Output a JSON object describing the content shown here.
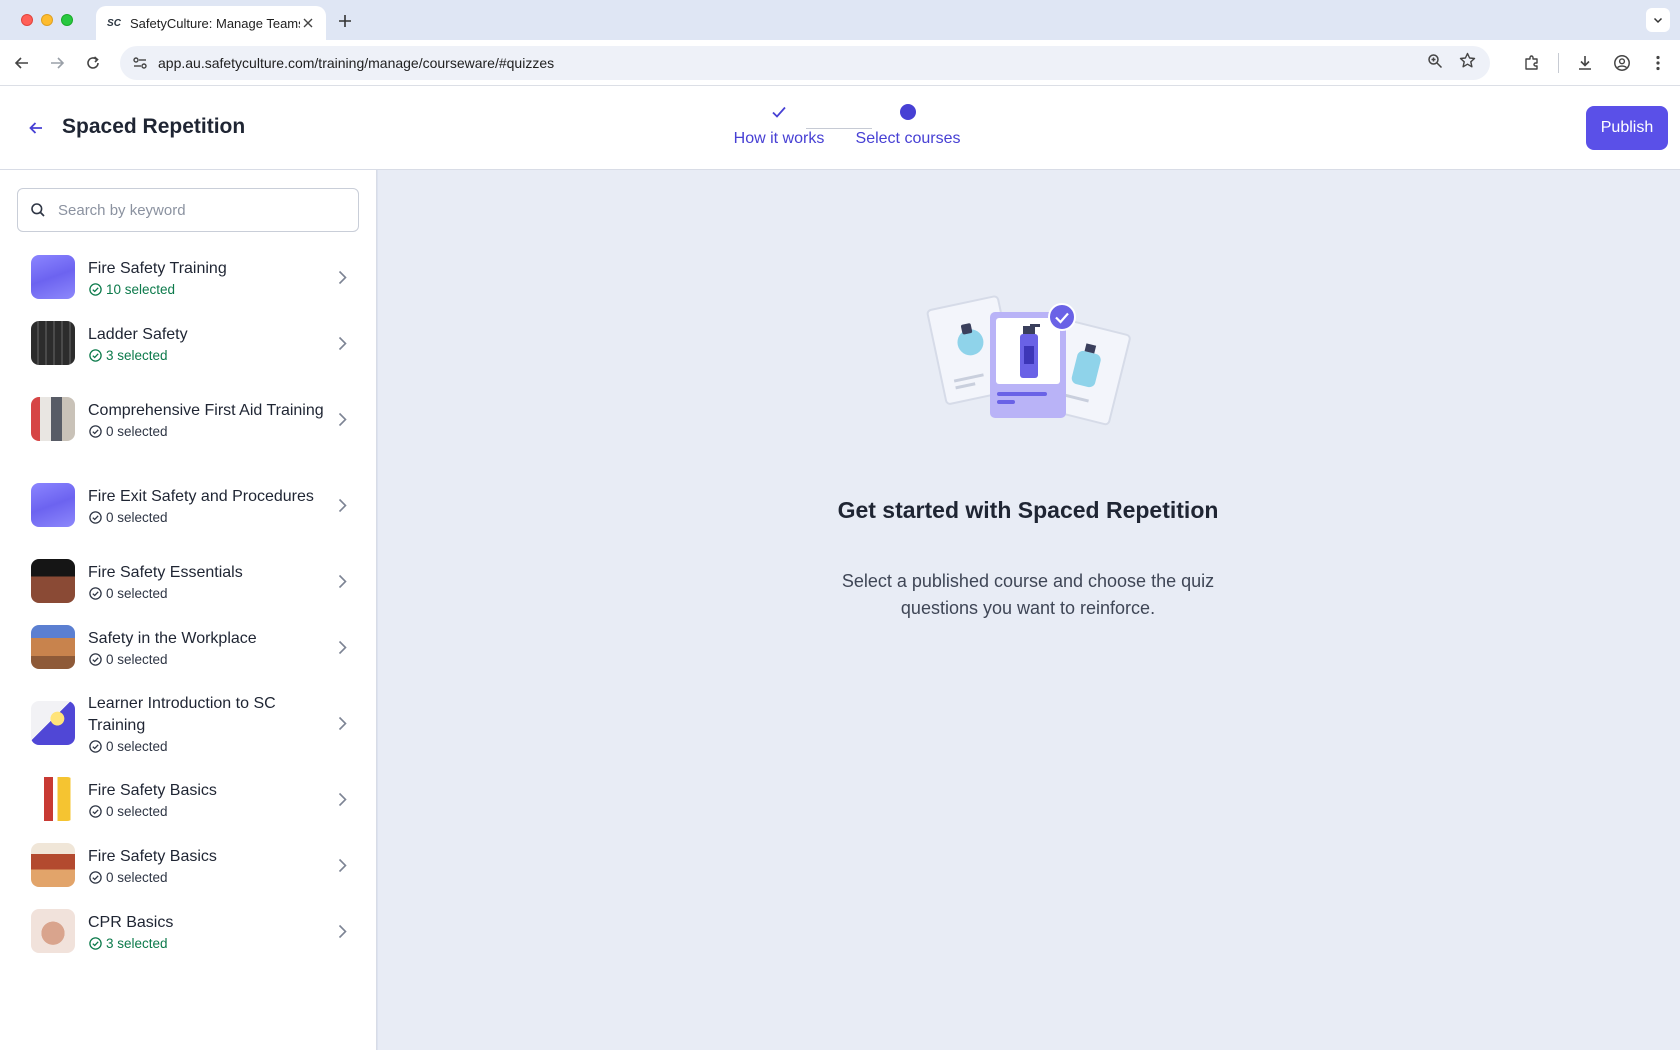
{
  "browser": {
    "tab_title": "SafetyCulture: Manage Teams",
    "tab_favicon": "SC",
    "url": "app.au.safetyculture.com/training/manage/courseware/#quizzes",
    "icons": [
      "back-arrow-icon",
      "forward-arrow-icon",
      "reload-icon",
      "site-info-icon",
      "zoom-icon",
      "bookmark-star-icon",
      "extensions-icon",
      "download-icon",
      "profile-icon",
      "more-vert-icon"
    ]
  },
  "header": {
    "title": "Spaced Repetition",
    "publish_label": "Publish",
    "steps": [
      {
        "label": "How it works",
        "state": "complete"
      },
      {
        "label": "Select courses",
        "state": "current"
      }
    ]
  },
  "search": {
    "placeholder": "Search by keyword"
  },
  "courses": [
    {
      "name": "Fire Safety Training",
      "status": "10 selected",
      "highlight": true
    },
    {
      "name": "Ladder Safety",
      "status": "3 selected",
      "highlight": true
    },
    {
      "name": "Comprehensive First Aid Training",
      "status": "0 selected",
      "highlight": false
    },
    {
      "name": "Fire Exit Safety and Procedures",
      "status": "0 selected",
      "highlight": false
    },
    {
      "name": "Fire Safety Essentials",
      "status": "0 selected",
      "highlight": false
    },
    {
      "name": "Safety in the Workplace",
      "status": "0 selected",
      "highlight": false
    },
    {
      "name": "Learner Introduction to SC Training",
      "status": "0 selected",
      "highlight": false
    },
    {
      "name": "Fire Safety Basics",
      "status": "0 selected",
      "highlight": false
    },
    {
      "name": "Fire Safety Basics",
      "status": "0 selected",
      "highlight": false
    },
    {
      "name": "CPR Basics",
      "status": "3 selected",
      "highlight": true
    }
  ],
  "empty_state": {
    "title": "Get started with Spaced Repetition",
    "description": "Select a published course and choose the quiz questions you want to reinforce."
  },
  "colors": {
    "accent": "#5a50e8",
    "step_active": "#4740d4",
    "selected_green": "#0c7a4b",
    "main_bg": "#e8ecf5"
  }
}
